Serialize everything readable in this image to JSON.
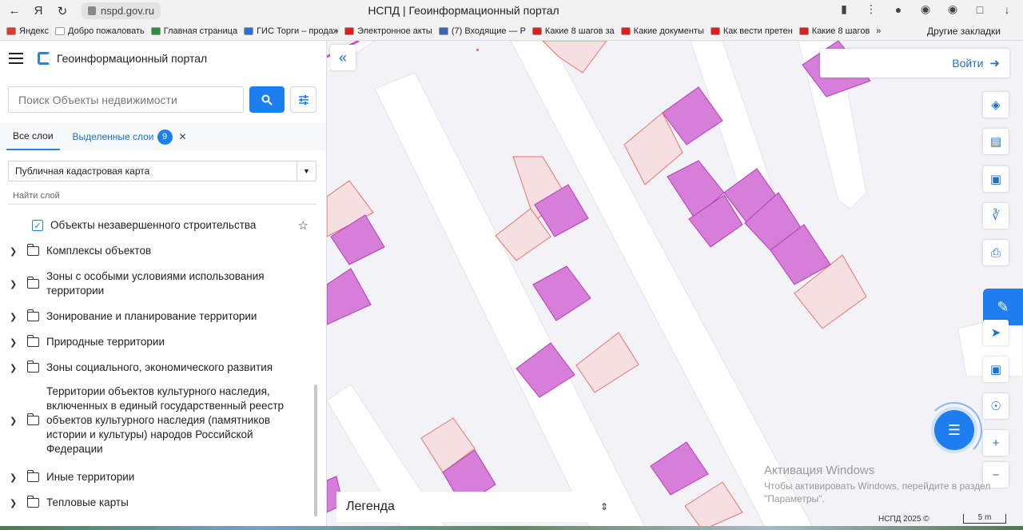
{
  "browser": {
    "url": "nspd.gov.ru",
    "page_title": "НСПД | Геоинформационный портал",
    "bookmarks": [
      {
        "label": "Яндекс",
        "color": "#e03a2f"
      },
      {
        "label": "Добро пожаловать",
        "color": "#ffffff"
      },
      {
        "label": "Главная страница",
        "color": "#2d8f3c"
      },
      {
        "label": "ГИС Торги – продажа",
        "color": "#2d6fd0"
      },
      {
        "label": "Электронное акты",
        "color": "#e01e1e"
      },
      {
        "label": "(7) Входящие — Р",
        "color": "#3a66b7"
      },
      {
        "label": "Какие 8 шагов за",
        "color": "#e01e1e"
      },
      {
        "label": "Какие документы",
        "color": "#e01e1e"
      },
      {
        "label": "Как вести претен",
        "color": "#e01e1e"
      },
      {
        "label": "Какие 8 шагов",
        "color": "#e01e1e"
      }
    ],
    "more_bookmarks": "»",
    "other_bookmarks": "Другие закладки"
  },
  "panel": {
    "title": "Геоинформационный портал",
    "search_placeholder": "Поиск Объекты недвижимости",
    "tab_all": "Все слои",
    "tab_selected": "Выделенные слои",
    "selected_count": "9",
    "basemap": "Публичная кадастровая карта",
    "find_layer": "Найти слой",
    "checked_layer": "Объекты незавершенного строительства",
    "folders": [
      "Комплексы объектов",
      "Зоны с особыми условиями использования территории",
      "Зонирование и планирование территории",
      "Природные территории",
      "Зоны социального, экономического развития",
      "Территории объектов культурного наследия, включенных в единый государственный реестр объектов культурного наследия (памятников истории и культуры) народов Российской Федерации",
      "Иные территории",
      "Тепловые карты"
    ]
  },
  "map": {
    "login_label": "Войти",
    "legend_label": "Легенда",
    "watermark_title": "Активация Windows",
    "watermark_text": "Чтобы активировать Windows, перейдите в раздел \"Параметры\".",
    "copyright": "НСПД 2025 ©",
    "scale": "5 m",
    "colors": {
      "magenta_fill": "#d67ed9",
      "magenta_stroke": "#b23db8",
      "pink_fill": "#f6dfe0",
      "pink_stroke": "#e8736f",
      "road": "#ffffff"
    }
  }
}
